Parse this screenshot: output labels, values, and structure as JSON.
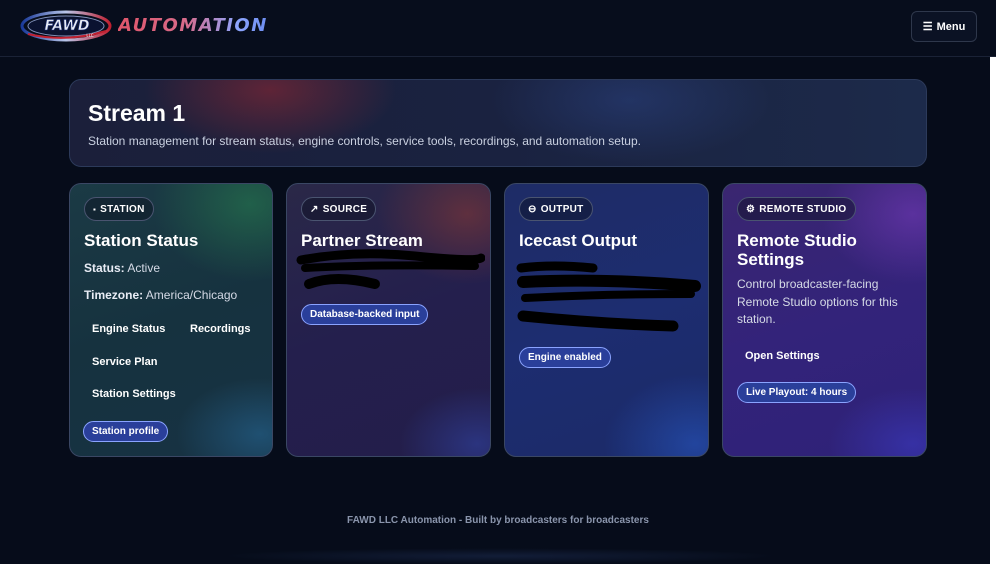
{
  "header": {
    "logo_text": "FAWD",
    "logo_subtext": "LLC",
    "brand": "AUTOMATION",
    "menu_label": "Menu"
  },
  "hero": {
    "title": "Stream 1",
    "subtitle": "Station management for stream status, engine controls, service tools, recordings, and automation setup."
  },
  "cards": {
    "station": {
      "tag": "STATION",
      "title": "Station Status",
      "status_label": "Status:",
      "status_value": "Active",
      "timezone_label": "Timezone:",
      "timezone_value": "America/Chicago",
      "links": {
        "engine_status": "Engine Status",
        "recordings": "Recordings",
        "service_plan": "Service Plan",
        "station_settings": "Station Settings"
      },
      "pill": "Station profile"
    },
    "source": {
      "tag": "SOURCE",
      "title": "Partner Stream",
      "pill": "Database-backed input"
    },
    "output": {
      "tag": "OUTPUT",
      "title": "Icecast Output",
      "pill": "Engine enabled"
    },
    "remote": {
      "tag": "REMOTE STUDIO",
      "title": "Remote Studio Settings",
      "description": "Control broadcaster-facing Remote Studio options for this station.",
      "link": "Open Settings",
      "pill": "Live Playout: 4 hours"
    }
  },
  "footer": {
    "text": "FAWD LLC Automation - Built by broadcasters for broadcasters"
  },
  "icons": {
    "station": "dot-icon",
    "source": "pin-icon",
    "output": "broadcast-icon",
    "remote": "gear-icon",
    "menu": "hamburger-icon"
  },
  "colors": {
    "background": "#060c1a",
    "pill_bg": "#2a3f9a",
    "pill_border": "#8aa3ff",
    "brand_red": "#e0566a",
    "brand_blue": "#8ea6ff"
  }
}
